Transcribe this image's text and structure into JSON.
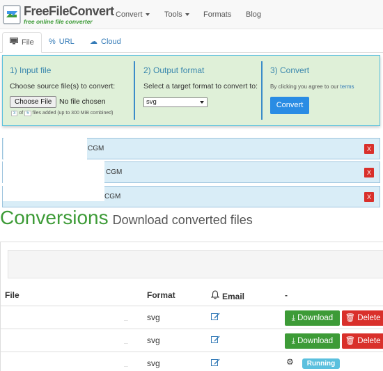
{
  "brand": {
    "name": "FreeFileConvert",
    "tagline": "free online file converter"
  },
  "nav": {
    "items": [
      "Convert",
      "Tools",
      "Formats",
      "Blog"
    ]
  },
  "tabs": [
    {
      "label": "File",
      "icon": "monitor-icon",
      "active": true
    },
    {
      "label": "URL",
      "icon": "link-icon",
      "active": false
    },
    {
      "label": "Cloud",
      "icon": "cloud-icon",
      "active": false
    }
  ],
  "upload": {
    "step1_title": "1) Input file",
    "step1_text": "Choose source file(s) to convert:",
    "choose_button": "Choose File",
    "no_file": "No file chosen",
    "files_added_count": "3",
    "files_of": "of",
    "files_max": "5",
    "files_added_text": "files added (up to 300 MiB combined)",
    "step2_title": "2) Output format",
    "step2_text": "Select a target format to convert to:",
    "format_selected": "svg",
    "step3_title": "3) Convert",
    "agree_text": "By clicking you agree to our",
    "terms_link": "terms",
    "convert_button": "Convert"
  },
  "queue": [
    {
      "name_visible": "CGM",
      "remove": "X"
    },
    {
      "name_visible": "CGM",
      "remove": "X"
    },
    {
      "name_visible": "CGM",
      "remove": "X"
    }
  ],
  "conversions": {
    "title": "Conversions",
    "subtitle": "Download converted files",
    "headers": {
      "file": "File",
      "format": "Format",
      "email": "Email",
      "actions": "-"
    },
    "rows": [
      {
        "dots": "...",
        "format": "svg",
        "status": "done",
        "download": "Download",
        "delete": "Delete"
      },
      {
        "dots": "...",
        "format": "svg",
        "status": "done",
        "download": "Download",
        "delete": "Delete"
      },
      {
        "dots": "...",
        "format": "svg",
        "status": "Running"
      }
    ]
  },
  "colors": {
    "brand_green": "#3d9b37",
    "panel_bg": "#dff0d8",
    "accent_blue": "#2a8ce4",
    "danger_red": "#d9302b",
    "info_blue": "#5bc0de"
  }
}
